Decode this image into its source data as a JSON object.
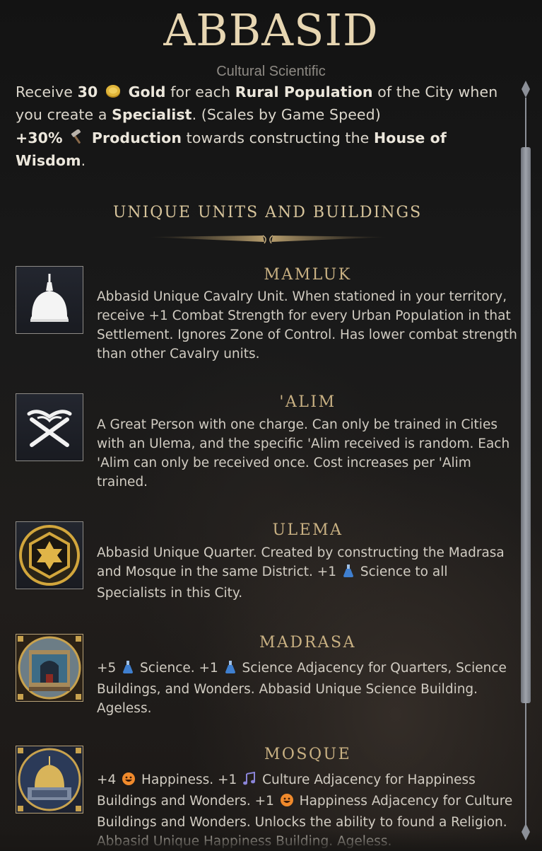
{
  "header": {
    "civ_name": "ABBASID",
    "tags": "Cultural Scientific"
  },
  "abilities": {
    "line1": {
      "p1": "Receive ",
      "amount": "30",
      "gold_icon": "gold-coin-icon",
      "gold": "Gold",
      "p2": " for each ",
      "rural": "Rural Population",
      "p3": " of the City when you create a ",
      "specialist": "Specialist",
      "p4": ". (Scales by Game Speed)"
    },
    "line2": {
      "pct": "+30%",
      "hammer_icon": "hammer-icon",
      "production": "Production",
      "p1": " towards constructing the ",
      "building": "House of Wisdom",
      "p2": "."
    }
  },
  "section": {
    "title": "UNIQUE UNITS AND BUILDINGS"
  },
  "units": [
    {
      "name": "MAMLUK",
      "icon": "mamluk-helmet-icon",
      "desc": "Abbasid Unique Cavalry Unit. When stationed in your territory, receive +1 Combat Strength for every Urban Population in that Settlement. Ignores Zone of Control. Has lower combat strength than other Cavalry units."
    },
    {
      "name": "'ALIM",
      "icon": "open-book-icon",
      "desc": "A Great Person with one charge. Can only be trained in Cities with an Ulema, and the specific 'Alim received is random. Each 'Alim can only be received once. Cost increases per 'Alim trained."
    },
    {
      "name": "ULEMA",
      "icon": "ulema-star-icon",
      "desc_p1": "Abbasid Unique Quarter. Created by constructing the Madrasa and Mosque in the same District. +1 ",
      "desc_science": " Science to all Specialists in this City."
    },
    {
      "name": "MADRASA",
      "icon": "madrasa-building-icon",
      "desc_p1": "+5 ",
      "desc_p2": " Science. +1 ",
      "desc_p3": " Science Adjacency for Quarters, Science Buildings, and Wonders. Abbasid Unique Science Building. Ageless."
    },
    {
      "name": "MOSQUE",
      "icon": "mosque-dome-icon",
      "desc_p1": "+4 ",
      "desc_p2": " Happiness. +1 ",
      "desc_p3": " Culture Adjacency for Happiness Buildings and Wonders. +1 ",
      "desc_p4": " Happiness Adjacency for Culture Buildings and Wonders. Unlocks the ability to found a Religion. Abbasid Unique Happiness Building. Ageless."
    }
  ],
  "colors": {
    "title": "#e7d6b2",
    "section": "#d7c49b",
    "unit_name": "#c9b183",
    "gold": "#d4a72c",
    "science": "#4a86c9"
  }
}
